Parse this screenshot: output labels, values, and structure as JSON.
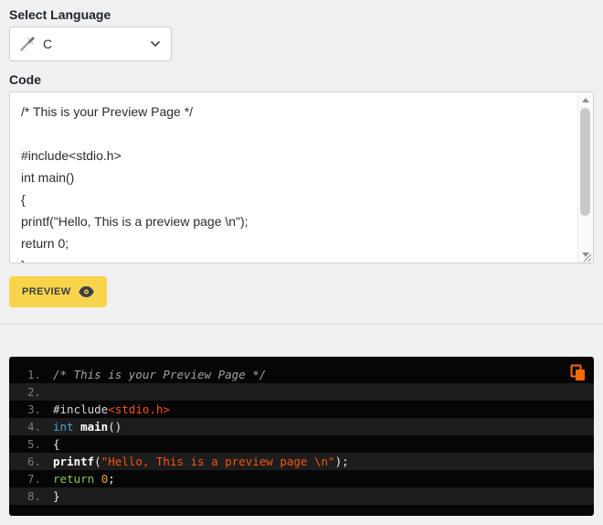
{
  "header": {
    "select_language_label": "Select Language",
    "code_label": "Code"
  },
  "language_select": {
    "selected": "C"
  },
  "editor": {
    "code": "/* This is your Preview Page */\n\n#include<stdio.h>\nint main()\n{\nprintf(\"Hello, This is a preview page \\n\");\nreturn 0;\n}"
  },
  "preview_button": {
    "label": "PREVIEW"
  },
  "preview_panel": {
    "lines": [
      {
        "num": "1.",
        "tokens": [
          {
            "c": "comment",
            "t": "/* This is your Preview Page */"
          }
        ]
      },
      {
        "num": "2.",
        "tokens": []
      },
      {
        "num": "3.",
        "tokens": [
          {
            "c": "meta",
            "t": "#include"
          },
          {
            "c": "string",
            "t": "<stdio.h>"
          }
        ]
      },
      {
        "num": "4.",
        "tokens": [
          {
            "c": "type",
            "t": "int"
          },
          {
            "c": "plain",
            "t": " "
          },
          {
            "c": "func",
            "t": "main"
          },
          {
            "c": "plain",
            "t": "()"
          }
        ]
      },
      {
        "num": "5.",
        "tokens": [
          {
            "c": "plain",
            "t": "{"
          }
        ]
      },
      {
        "num": "6.",
        "tokens": [
          {
            "c": "func",
            "t": "printf"
          },
          {
            "c": "plain",
            "t": "("
          },
          {
            "c": "string",
            "t": "\"Hello, This is a preview page \\n\""
          },
          {
            "c": "plain",
            "t": ");"
          }
        ]
      },
      {
        "num": "7.",
        "tokens": [
          {
            "c": "keyword",
            "t": "return"
          },
          {
            "c": "plain",
            "t": " "
          },
          {
            "c": "number",
            "t": "0"
          },
          {
            "c": "plain",
            "t": ";"
          }
        ]
      },
      {
        "num": "8.",
        "tokens": [
          {
            "c": "plain",
            "t": "}"
          }
        ]
      }
    ]
  },
  "colors": {
    "accent_yellow": "#f8d44c",
    "panel_bg": "#060606",
    "alt_line": "#1d1d1d",
    "line_number": "#7a7a7a",
    "comment": "#a2a2a2",
    "plain": "#eaeaea",
    "meta": "#d6d6d6",
    "string": "#f4540e",
    "type": "#4ea3d8",
    "keyword": "#8fc54c",
    "number": "#f39c2c",
    "func": "#ffffff",
    "copy_icon": "#ff6a00"
  }
}
